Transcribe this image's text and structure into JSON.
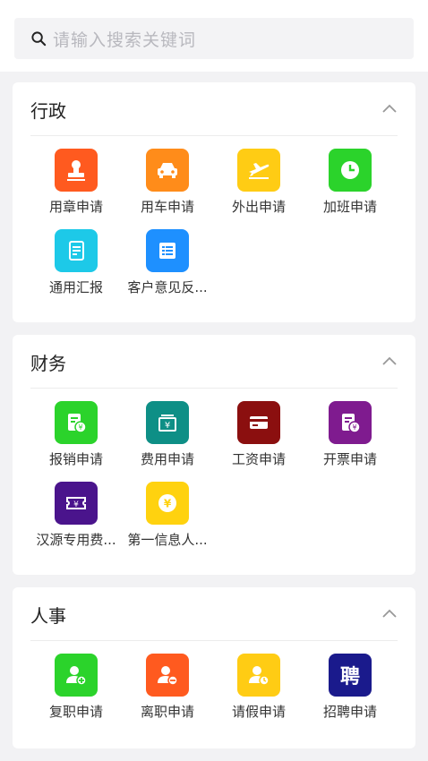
{
  "search": {
    "placeholder": "请输入搜索关键词"
  },
  "sections": [
    {
      "title": "行政",
      "items": [
        {
          "label": "用章申请",
          "icon": "stamp-icon",
          "color": "#ff5a1f"
        },
        {
          "label": "用车申请",
          "icon": "car-icon",
          "color": "#ff8c1a"
        },
        {
          "label": "外出申请",
          "icon": "plane-icon",
          "color": "#ffcc14"
        },
        {
          "label": "加班申请",
          "icon": "clock-icon",
          "color": "#2bd32b"
        },
        {
          "label": "通用汇报",
          "icon": "report-icon",
          "color": "#1dc9e8"
        },
        {
          "label": "客户意见反...",
          "icon": "list-icon",
          "color": "#1e90ff"
        }
      ]
    },
    {
      "title": "财务",
      "items": [
        {
          "label": "报销申请",
          "icon": "reimburse-icon",
          "color": "#2bd32b"
        },
        {
          "label": "费用申请",
          "icon": "expense-icon",
          "color": "#0e8f86"
        },
        {
          "label": "工资申请",
          "icon": "salary-card-icon",
          "color": "#8b0f0f"
        },
        {
          "label": "开票申请",
          "icon": "invoice-icon",
          "color": "#7f1b8f"
        },
        {
          "label": "汉源专用费...",
          "icon": "ticket-icon",
          "color": "#4a148c"
        },
        {
          "label": "第一信息人...",
          "icon": "coin-icon",
          "color": "#ffd20f"
        }
      ]
    },
    {
      "title": "人事",
      "items": [
        {
          "label": "复职申请",
          "icon": "user-add-icon",
          "color": "#2bd32b"
        },
        {
          "label": "离职申请",
          "icon": "user-remove-icon",
          "color": "#ff5a1f"
        },
        {
          "label": "请假申请",
          "icon": "user-clock-icon",
          "color": "#ffcc14"
        },
        {
          "label": "招聘申请",
          "icon": "recruit-icon",
          "color": "#1a1a8c",
          "glyph": "聘"
        }
      ]
    }
  ]
}
